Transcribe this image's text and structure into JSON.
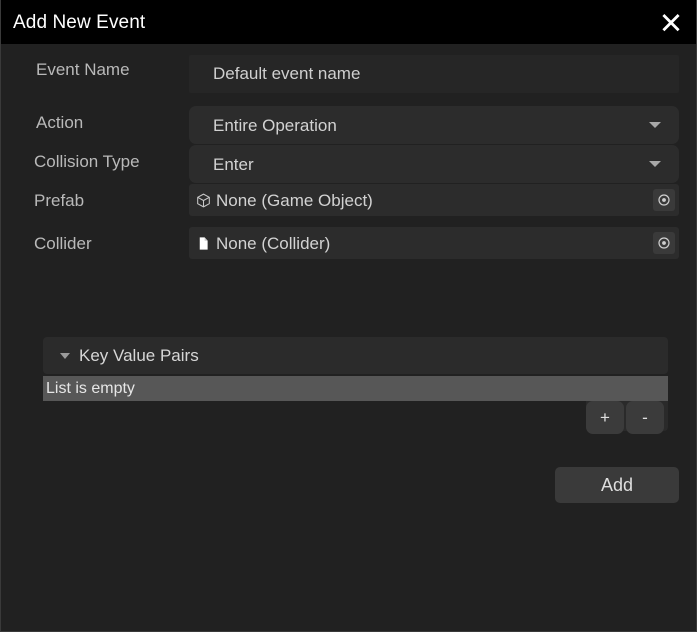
{
  "window": {
    "title": "Add New Event",
    "close_icon": "close-icon"
  },
  "form": {
    "fields": [
      {
        "label": "Event Name",
        "type": "text",
        "value": "Default event name",
        "placeholder": "Default event name"
      },
      {
        "label": "Action",
        "type": "dropdown",
        "value": "Entire Operation",
        "caret_icon": "chevron-down-icon"
      },
      {
        "label": "Collision Type",
        "type": "dropdown",
        "value": "Enter",
        "caret_icon": "chevron-down-icon"
      },
      {
        "label": "Prefab",
        "type": "object",
        "value": "None (Game Object)",
        "icon": "game-object-cube-icon",
        "picker_icon": "object-picker-target-icon"
      },
      {
        "label": "Collider",
        "type": "object",
        "value": "None (Collider)",
        "icon": "script-file-icon",
        "picker_icon": "object-picker-target-icon"
      }
    ]
  },
  "list_section": {
    "foldout_label": "Key Value Pairs",
    "foldout_caret_icon": "triangle-down-icon",
    "expanded": true,
    "empty_message": "List is empty",
    "items": [],
    "add_item_label": "+",
    "remove_item_label": "-"
  },
  "footer": {
    "add_label": "Add"
  },
  "colors": {
    "titlebar_bg": "#000000",
    "dialog_bg": "#212121",
    "field_bg": "#2c2c2c",
    "text_field_bg": "#262626",
    "empty_row_bg": "#575757",
    "button_bg": "#3a3a3a",
    "label_text": "#b9b9b9",
    "value_text": "#d2d2d2",
    "title_text": "#ffffff"
  }
}
